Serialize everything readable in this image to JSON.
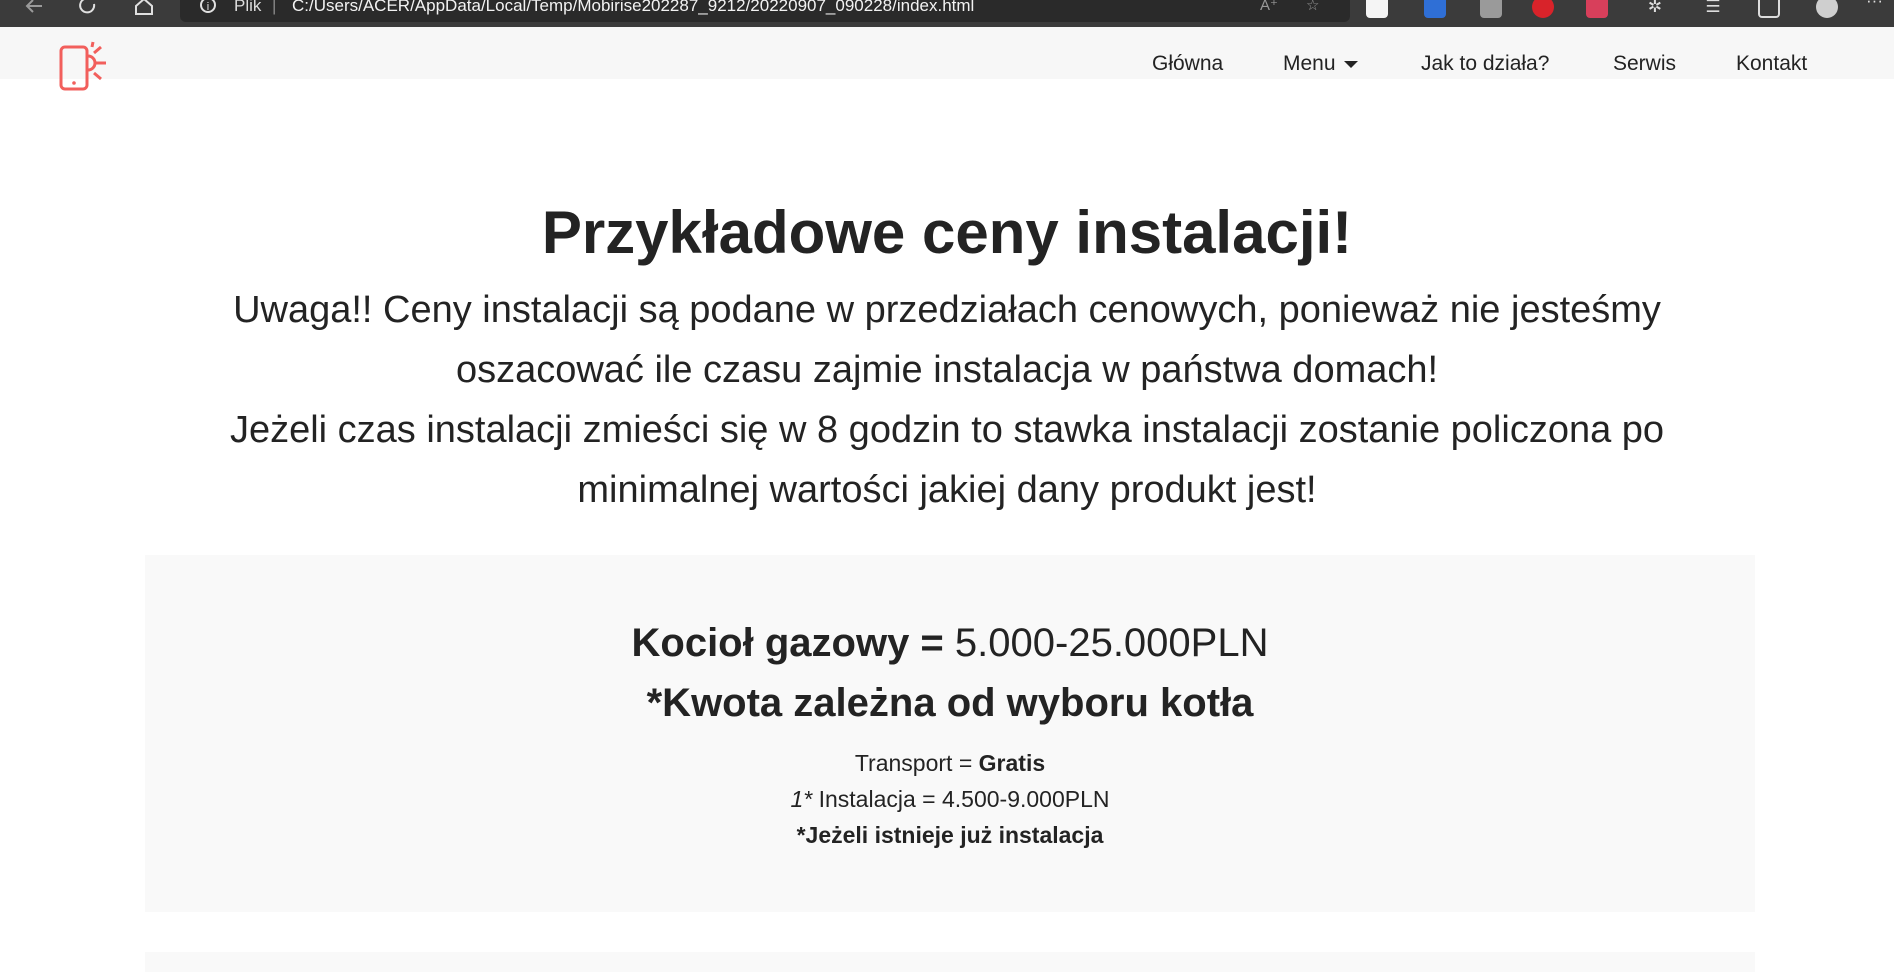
{
  "browser": {
    "protocol_label": "Plik",
    "url": "C:/Users/ACER/AppData/Local/Temp/Mobirise202287_9212/20220907_090228/index.html",
    "reader_label": "A⁺"
  },
  "header": {
    "nav": [
      "Główna",
      "Menu",
      "Jak to działa?",
      "Serwis",
      "Kontakt"
    ]
  },
  "hero": {
    "title": "Przykładowe ceny instalacji!",
    "note1": "Uwaga!! Ceny instalacji są podane w przedziałach cenowych, ponieważ nie jesteśmy oszacować ile czasu zajmie instalacja w państwa domach!",
    "note2": "Jeżeli czas instalacji zmieści się w 8 godzin to stawka instalacji zostanie policzona po minimalnej wartości jakiej dany produkt jest!"
  },
  "card": {
    "product_label": "Kocioł gazowy =",
    "product_price": " 5.000-25.000PLN",
    "subtitle": "*Kwota zależna od wyboru kotła",
    "transport_label": "Transport = ",
    "transport_value": "Gratis",
    "install_prefix": "1*",
    "install_text": " Instalacja = 4.500-9.000PLN",
    "footnote": "*Jeżeli istnieje już instalacja"
  },
  "colors": {
    "accent": "#f25f5c",
    "browser_bar": "#3b3b3b",
    "header_bg": "#f7f7f7",
    "card_bg": "#f9f9f9",
    "text": "#232323"
  }
}
